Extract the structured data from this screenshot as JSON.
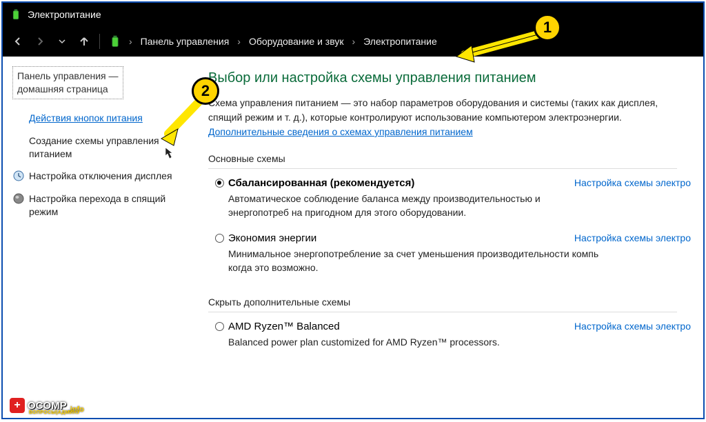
{
  "window": {
    "title": "Электропитание"
  },
  "breadcrumb": {
    "seg1": "Панель управления",
    "seg2": "Оборудование и звук",
    "seg3": "Электропитание"
  },
  "sidebar": {
    "home1": "Панель управления —",
    "home2": "домашняя страница",
    "links": [
      {
        "label": "Действия кнопок питания",
        "underline": true
      },
      {
        "label": "Создание схемы управления питанием"
      },
      {
        "label": "Настройка отключения дисплея",
        "icon": "clock"
      },
      {
        "label": "Настройка перехода в спящий режим",
        "icon": "sphere"
      }
    ]
  },
  "main": {
    "heading": "Выбор или настройка схемы управления питанием",
    "desc_pre": "Схема управления питанием — это набор параметров оборудования и системы (таких как дисплея, спящий режим и т. д.), которые контролируют использование компьютером электроэнергии. ",
    "desc_link": "Дополнительные сведения о схемах управления питанием",
    "section_basic": "Основные схемы",
    "section_extra": "Скрыть дополнительные схемы",
    "configure_label": "Настройка схемы электро",
    "plans": [
      {
        "name": "Сбалансированная (рекомендуется)",
        "selected": true,
        "bold": true,
        "desc": "Автоматическое соблюдение баланса между производительностью и энергопотреб на пригодном для этого оборудовании."
      },
      {
        "name": "Экономия энергии",
        "selected": false,
        "desc": "Минимальное энергопотребление за счет уменьшения производительности компь когда это возможно."
      }
    ],
    "extra_plans": [
      {
        "name": "AMD Ryzen™ Balanced",
        "selected": false,
        "desc": "Balanced power plan customized for AMD Ryzen™ processors."
      }
    ]
  },
  "markers": {
    "m1": "1",
    "m2": "2"
  },
  "brand": {
    "name": "OCOMP",
    "suffix": ".info",
    "sub": "ВОПРОСЫ|АДМИНУ"
  }
}
